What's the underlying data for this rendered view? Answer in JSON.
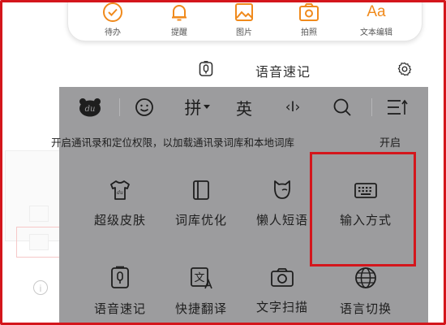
{
  "quick_bar": {
    "items": [
      {
        "label": "待办",
        "icon": "check-circle-icon"
      },
      {
        "label": "提醒",
        "icon": "bell-icon"
      },
      {
        "label": "图片",
        "icon": "image-icon"
      },
      {
        "label": "拍照",
        "icon": "camera-icon"
      },
      {
        "label": "文本编辑",
        "icon": "text-format-icon",
        "glyph": "Aa"
      }
    ]
  },
  "voice_notes": {
    "title": "语音速记",
    "icon": "microphone-icon"
  },
  "keyboard": {
    "toolbar": {
      "logo": "du",
      "pinyin": "拼",
      "english": "英",
      "cursor_glyph": "‹I›"
    },
    "notice": {
      "text": "开启通讯录和定位权限，以加载通讯录词库和本地词库",
      "action": "开启"
    },
    "tiles": [
      {
        "label": "超级皮肤",
        "icon": "shirt-icon"
      },
      {
        "label": "词库优化",
        "icon": "book-icon"
      },
      {
        "label": "懒人短语",
        "icon": "cat-icon"
      },
      {
        "label": "输入方式",
        "icon": "keyboard-icon"
      },
      {
        "label": "语音速记",
        "icon": "voice-note-icon"
      },
      {
        "label": "快捷翻译",
        "icon": "translate-icon",
        "glyph": "文"
      },
      {
        "label": "文字扫描",
        "icon": "camera-scan-icon"
      },
      {
        "label": "语言切换",
        "icon": "globe-icon"
      }
    ]
  },
  "info_glyph": "i",
  "colors": {
    "accent_orange": "#f08a1c",
    "panel_gray": "#9c9c9e",
    "highlight_red": "#d4161c"
  }
}
